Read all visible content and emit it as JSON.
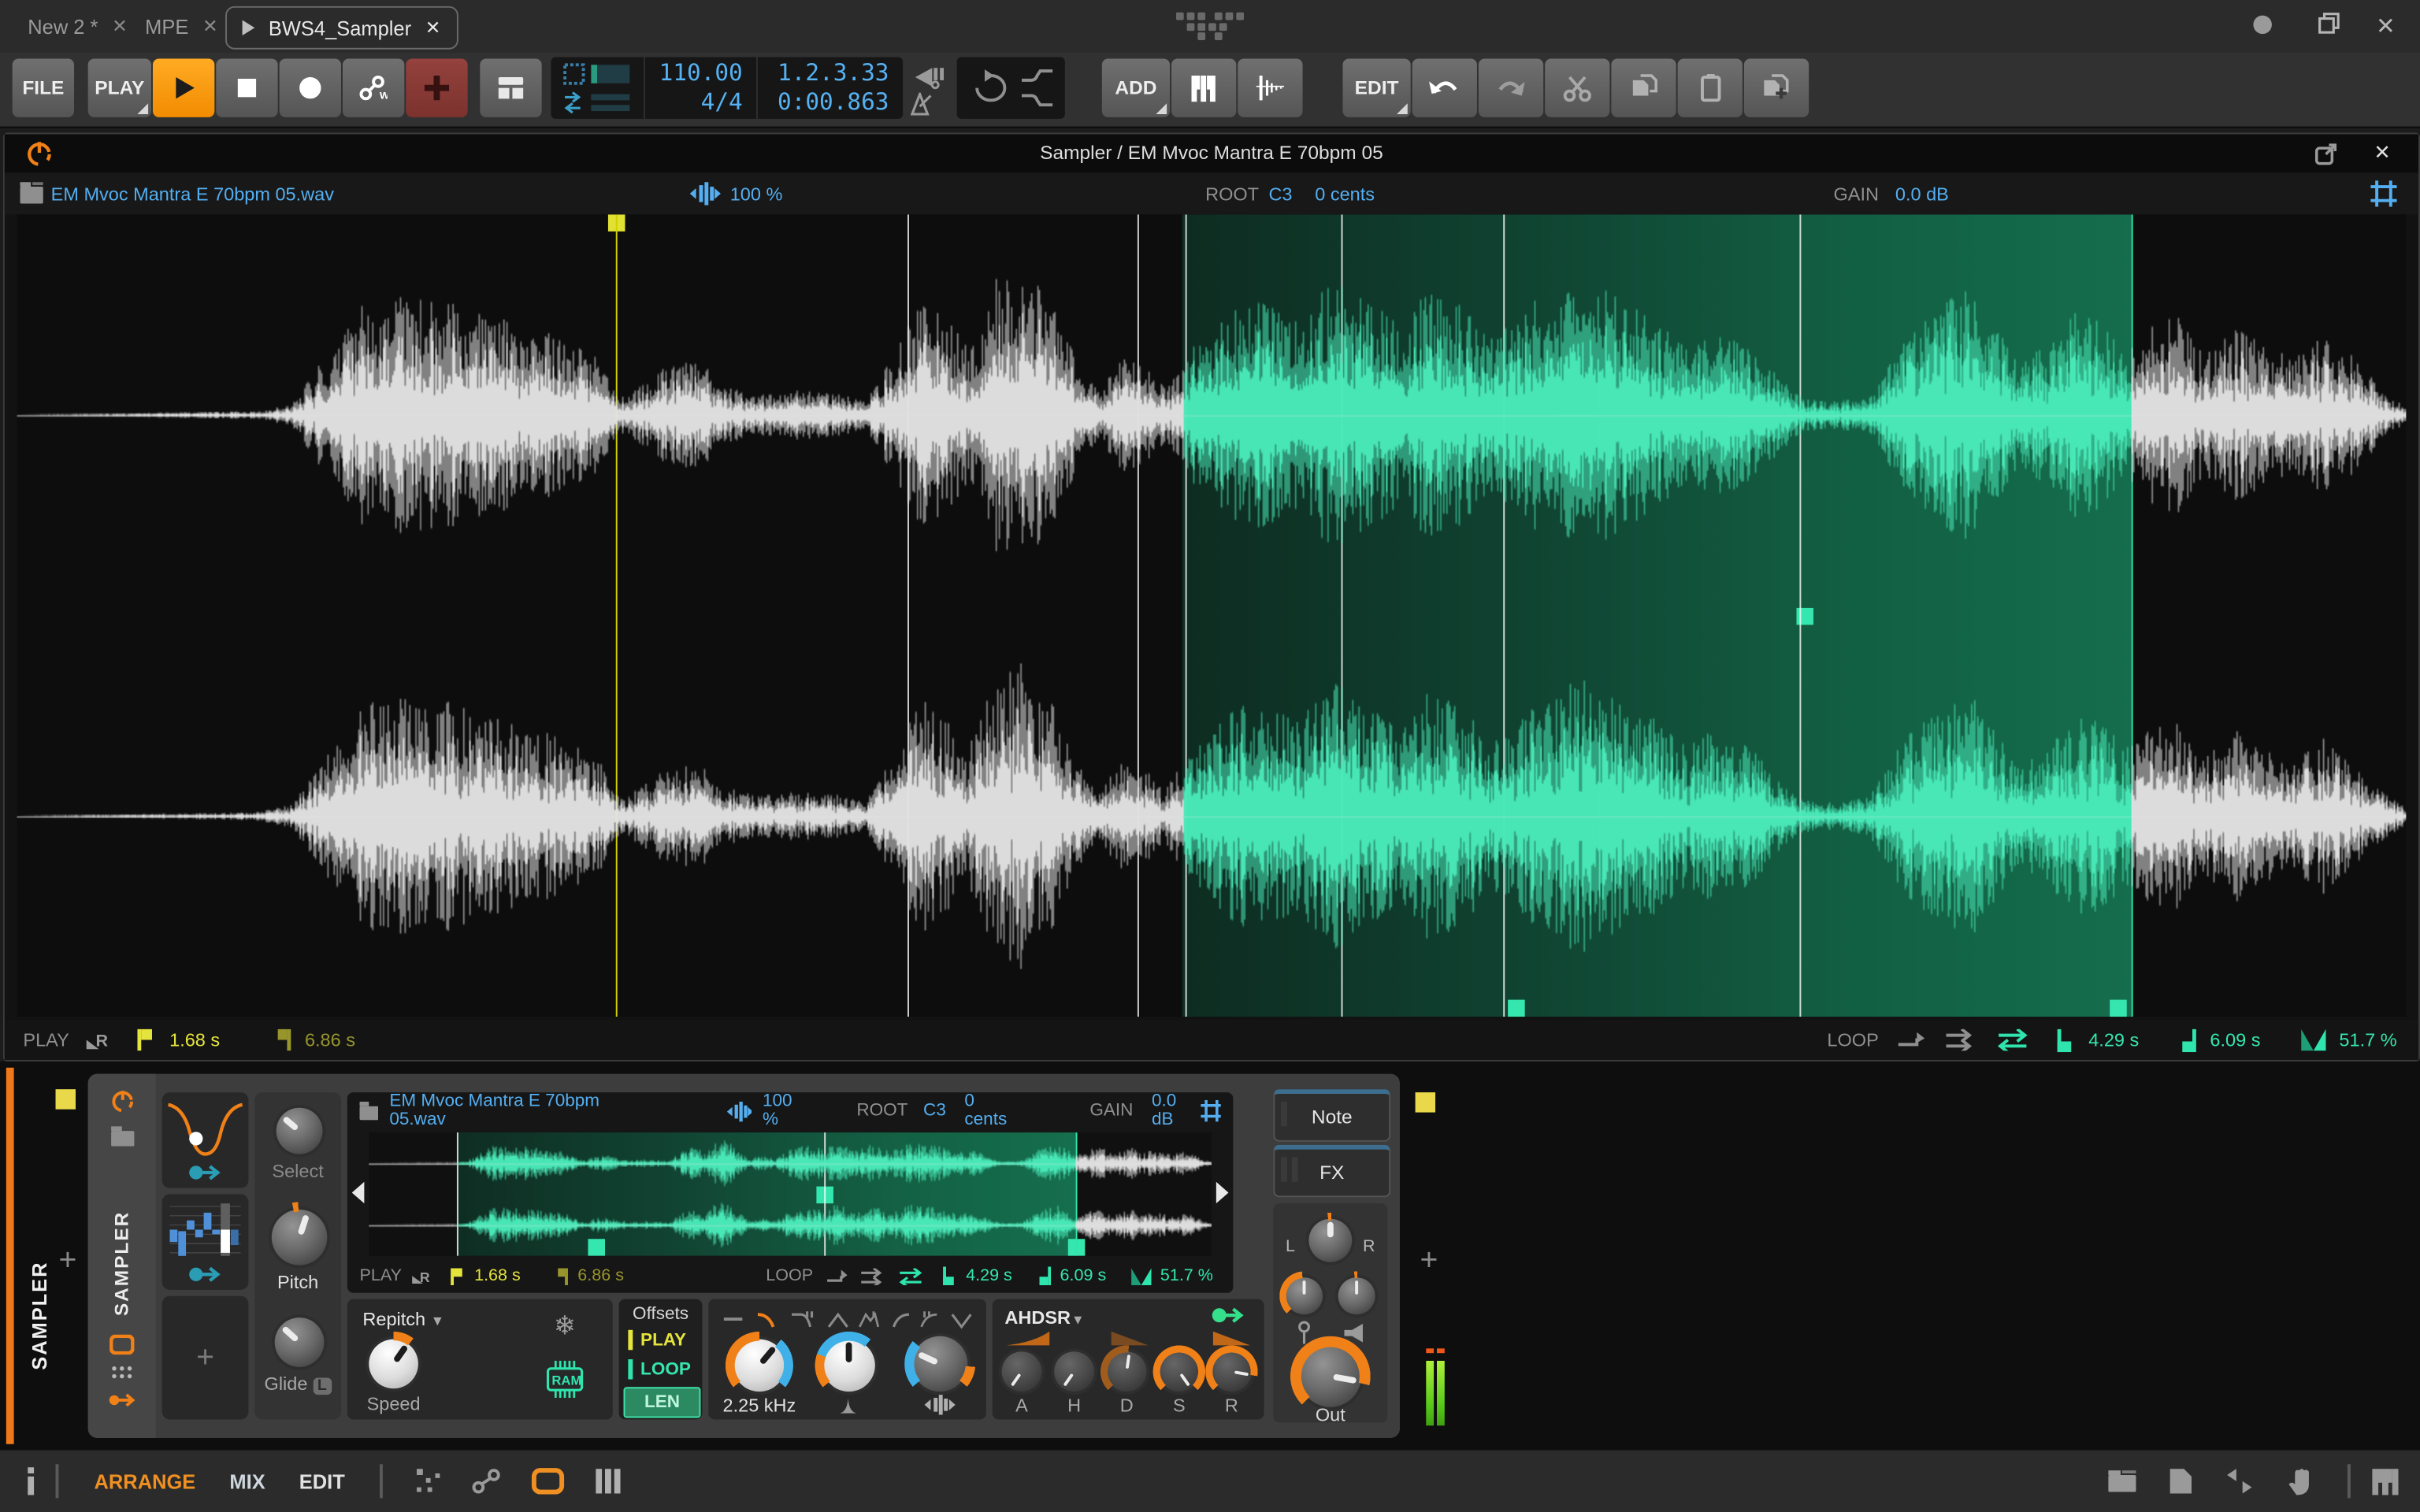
{
  "window": {
    "tabs": [
      {
        "label": "New 2 *",
        "close": "✕"
      },
      {
        "label": "MPE",
        "close": "✕"
      },
      {
        "label": "BWS4_Sampler",
        "close": "✕"
      }
    ]
  },
  "transport": {
    "file": "FILE",
    "play_menu": "PLAY",
    "tempo": "110.00",
    "timesig": "4/4",
    "position": "1.2.3.33",
    "time": "0:00.863",
    "add": "ADD",
    "edit": "EDIT"
  },
  "editor": {
    "title": "Sampler / EM Mvoc Mantra E 70bpm 05",
    "file": "EM Mvoc Mantra E 70bpm 05.wav",
    "zoom": "100 %",
    "root_label": "ROOT",
    "root": "C3",
    "tune": "0 cents",
    "gain_label": "GAIN",
    "gain": "0.0 dB",
    "status": {
      "play_label": "PLAY",
      "rec": "R",
      "start": "1.68 s",
      "end": "6.86 s",
      "loop_label": "LOOP",
      "loop_start": "4.29 s",
      "loop_end": "6.09 s",
      "xfade": "51.7 %"
    }
  },
  "device": {
    "track": "SAMPLER",
    "name": "SAMPLER",
    "select": "Select",
    "pitch": "Pitch",
    "glide": "Glide",
    "glide_badge": "L",
    "mode": "Repitch",
    "speed": "Speed",
    "ram": "RAM",
    "offsets": {
      "title": "Offsets",
      "play": "PLAY",
      "loop": "LOOP",
      "len": "LEN"
    },
    "freq": "2.25 kHz",
    "env": "AHDSR",
    "env_knobs": [
      "A",
      "H",
      "D",
      "S",
      "R"
    ],
    "out": "Out",
    "pan_l": "L",
    "pan_r": "R",
    "tabs": {
      "note": "Note",
      "fx": "FX"
    }
  },
  "statusbar": {
    "arrange": "ARRANGE",
    "mix": "MIX",
    "edit": "EDIT"
  },
  "waveform": {
    "envelope": [
      [
        0,
        0
      ],
      [
        0.1,
        0.02
      ],
      [
        0.115,
        0.06
      ],
      [
        0.145,
        0.58
      ],
      [
        0.175,
        0.62
      ],
      [
        0.2,
        0.5
      ],
      [
        0.225,
        0.42
      ],
      [
        0.243,
        0.3
      ],
      [
        0.25,
        0.12
      ],
      [
        0.255,
        0.1
      ],
      [
        0.27,
        0.24
      ],
      [
        0.285,
        0.28
      ],
      [
        0.295,
        0.16
      ],
      [
        0.31,
        0.1
      ],
      [
        0.325,
        0.13
      ],
      [
        0.34,
        0.12
      ],
      [
        0.355,
        0.07
      ],
      [
        0.372,
        0.45
      ],
      [
        0.38,
        0.62
      ],
      [
        0.39,
        0.48
      ],
      [
        0.398,
        0.35
      ],
      [
        0.41,
        0.72
      ],
      [
        0.42,
        0.78
      ],
      [
        0.432,
        0.6
      ],
      [
        0.443,
        0.3
      ],
      [
        0.452,
        0.12
      ],
      [
        0.462,
        0.3
      ],
      [
        0.472,
        0.25
      ],
      [
        0.48,
        0.14
      ],
      [
        0.495,
        0.4
      ],
      [
        0.505,
        0.52
      ],
      [
        0.52,
        0.6
      ],
      [
        0.535,
        0.5
      ],
      [
        0.55,
        0.68
      ],
      [
        0.565,
        0.6
      ],
      [
        0.578,
        0.48
      ],
      [
        0.59,
        0.64
      ],
      [
        0.605,
        0.56
      ],
      [
        0.617,
        0.4
      ],
      [
        0.628,
        0.5
      ],
      [
        0.64,
        0.66
      ],
      [
        0.655,
        0.7
      ],
      [
        0.67,
        0.6
      ],
      [
        0.685,
        0.5
      ],
      [
        0.698,
        0.36
      ],
      [
        0.71,
        0.44
      ],
      [
        0.725,
        0.36
      ],
      [
        0.738,
        0.18
      ],
      [
        0.748,
        0.08
      ],
      [
        0.76,
        0.07
      ],
      [
        0.775,
        0.1
      ],
      [
        0.79,
        0.4
      ],
      [
        0.805,
        0.56
      ],
      [
        0.818,
        0.66
      ],
      [
        0.828,
        0.45
      ],
      [
        0.838,
        0.25
      ],
      [
        0.85,
        0.38
      ],
      [
        0.862,
        0.55
      ],
      [
        0.872,
        0.5
      ],
      [
        0.882,
        0.34
      ],
      [
        0.892,
        0.45
      ],
      [
        0.905,
        0.52
      ],
      [
        0.915,
        0.3
      ],
      [
        0.928,
        0.44
      ],
      [
        0.94,
        0.38
      ],
      [
        0.952,
        0.28
      ],
      [
        0.965,
        0.4
      ],
      [
        0.978,
        0.3
      ],
      [
        0.99,
        0.12
      ],
      [
        1,
        0.04
      ]
    ],
    "big": {
      "loop": [
        0.488,
        0.885
      ],
      "playhead": 0.2505,
      "lines": [
        0.373,
        0.469,
        0.489,
        0.554,
        0.622,
        0.746
      ],
      "handles_bottom": [
        0.627,
        0.879
      ],
      "handle_mid": 0.748
    },
    "mini": {
      "loop": [
        0.105,
        0.838
      ],
      "lines": [
        0.105,
        0.54
      ],
      "handles_bottom": [
        0.27,
        0.838
      ],
      "handle_mid": 0.54
    },
    "colors": {
      "wave": "#e2e2e2",
      "loop_wave": "#4aeab8",
      "playhead": "#d8d400",
      "line": "rgba(255,255,255,0.8)",
      "loop_line": "#2fe5ad",
      "accent": "#f09022",
      "blue": "#54aef0"
    }
  }
}
